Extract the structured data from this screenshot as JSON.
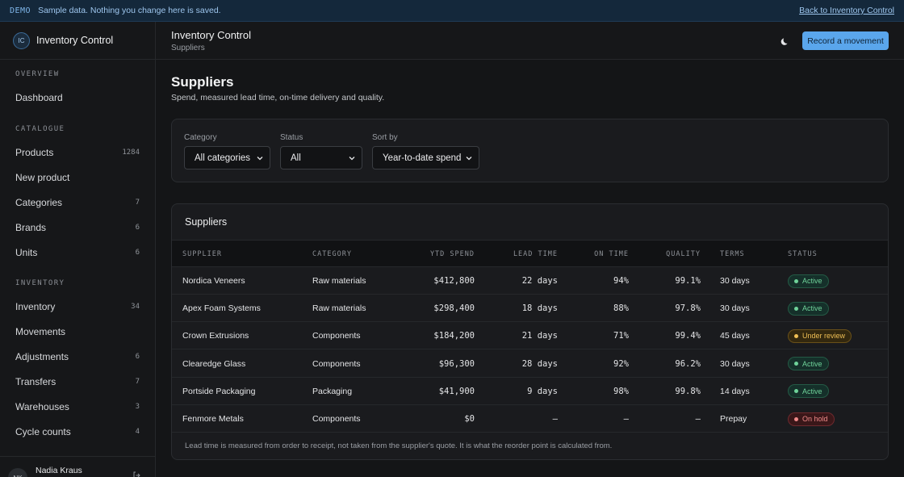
{
  "banner": {
    "tag": "DEMO",
    "message": "Sample data. Nothing you change here is saved.",
    "link": "Back to Inventory Control"
  },
  "brand": {
    "logo": "IC",
    "name": "Inventory Control"
  },
  "sidebar": {
    "sections": [
      {
        "title": "OVERVIEW",
        "items": [
          {
            "label": "Dashboard",
            "count": ""
          }
        ]
      },
      {
        "title": "CATALOGUE",
        "items": [
          {
            "label": "Products",
            "count": "1284"
          },
          {
            "label": "New product",
            "count": ""
          },
          {
            "label": "Categories",
            "count": "7"
          },
          {
            "label": "Brands",
            "count": "6"
          },
          {
            "label": "Units",
            "count": "6"
          }
        ]
      },
      {
        "title": "INVENTORY",
        "items": [
          {
            "label": "Inventory",
            "count": "34"
          },
          {
            "label": "Movements",
            "count": ""
          },
          {
            "label": "Adjustments",
            "count": "6"
          },
          {
            "label": "Transfers",
            "count": "7"
          },
          {
            "label": "Warehouses",
            "count": "3"
          },
          {
            "label": "Cycle counts",
            "count": "4"
          }
        ]
      }
    ]
  },
  "user": {
    "initials": "NK",
    "name": "Nadia Kraus",
    "action_icon": "logout-icon"
  },
  "header": {
    "title": "Inventory Control",
    "subtitle": "Suppliers",
    "theme_icon": "moon-icon",
    "cta_label": "Record a movement"
  },
  "page": {
    "title": "Suppliers",
    "description": "Spend, measured lead time, on-time delivery and quality."
  },
  "filters": {
    "category": {
      "label": "Category",
      "value": "All categories"
    },
    "status": {
      "label": "Status",
      "value": "All"
    },
    "sort": {
      "label": "Sort by",
      "value": "Year-to-date spend"
    }
  },
  "table": {
    "title": "Suppliers",
    "columns": [
      "SUPPLIER",
      "CATEGORY",
      "YTD SPEND",
      "LEAD TIME",
      "ON TIME",
      "QUALITY",
      "TERMS",
      "STATUS"
    ],
    "rows": [
      {
        "supplier": "Nordica Veneers",
        "category": "Raw materials",
        "spend": "$412,800",
        "lead": "22 days",
        "ontime": "94%",
        "quality": "99.1%",
        "terms": "30 days",
        "status": "Active",
        "tone": "active"
      },
      {
        "supplier": "Apex Foam Systems",
        "category": "Raw materials",
        "spend": "$298,400",
        "lead": "18 days",
        "ontime": "88%",
        "quality": "97.8%",
        "terms": "30 days",
        "status": "Active",
        "tone": "active"
      },
      {
        "supplier": "Crown Extrusions",
        "category": "Components",
        "spend": "$184,200",
        "lead": "21 days",
        "ontime": "71%",
        "quality": "99.4%",
        "terms": "45 days",
        "status": "Under review",
        "tone": "review"
      },
      {
        "supplier": "Clearedge Glass",
        "category": "Components",
        "spend": "$96,300",
        "lead": "28 days",
        "ontime": "92%",
        "quality": "96.2%",
        "terms": "30 days",
        "status": "Active",
        "tone": "active"
      },
      {
        "supplier": "Portside Packaging",
        "category": "Packaging",
        "spend": "$41,900",
        "lead": "9 days",
        "ontime": "98%",
        "quality": "99.8%",
        "terms": "14 days",
        "status": "Active",
        "tone": "active"
      },
      {
        "supplier": "Fenmore Metals",
        "category": "Components",
        "spend": "$0",
        "lead": "—",
        "ontime": "—",
        "quality": "—",
        "terms": "Prepay",
        "status": "On hold",
        "tone": "hold"
      }
    ],
    "footnote": "Lead time is measured from order to receipt, not taken from the supplier's quote. It is what the reorder point is calculated from."
  },
  "colors": {
    "accent": "#5aa6ec",
    "active": {
      "bg": "#15302a",
      "border": "#245a45",
      "text": "#6fd39a"
    },
    "review": {
      "bg": "#33280f",
      "border": "#6a5119",
      "text": "#f0bf55"
    },
    "hold": {
      "bg": "#3a1719",
      "border": "#6e2a2e",
      "text": "#f08a8a"
    }
  }
}
